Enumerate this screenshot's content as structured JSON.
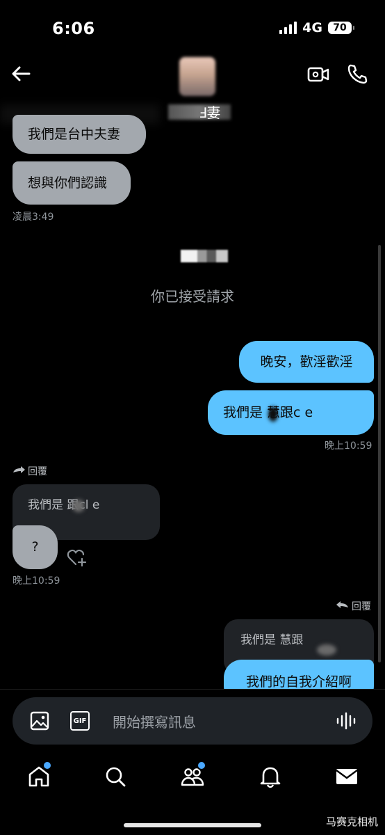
{
  "status_bar": {
    "time": "6:06",
    "network": "4G",
    "battery": "70"
  },
  "header": {
    "name_visible": "Ⅎ妻"
  },
  "messages": {
    "in1": "我們是台中夫妻",
    "in2": "想與你們認識",
    "time1": "凌晨3:49",
    "accepted_note": "你已接受請求",
    "out1": "晚安，歡淫歡淫",
    "out2": "我們是  慧跟c   e",
    "time2": "晚上10:59",
    "reply_label": "回覆",
    "quote1": "我們是  跟cl    e",
    "in3": "?",
    "time3": "晚上10:59",
    "reply_label2": "回覆",
    "quote2": "我們是  慧跟",
    "out3": "我們的自我介紹啊"
  },
  "composer": {
    "placeholder": "開始撰寫訊息",
    "gif_label": "GIF"
  },
  "nav": {
    "items": [
      "home-icon",
      "search-icon",
      "communities-icon",
      "notifications-icon",
      "messages-icon"
    ]
  },
  "watermark": "马赛克相机",
  "colors": {
    "accent": "#5cc3ff",
    "incoming": "#a3a8ae",
    "badge": "#4aa8ff"
  }
}
